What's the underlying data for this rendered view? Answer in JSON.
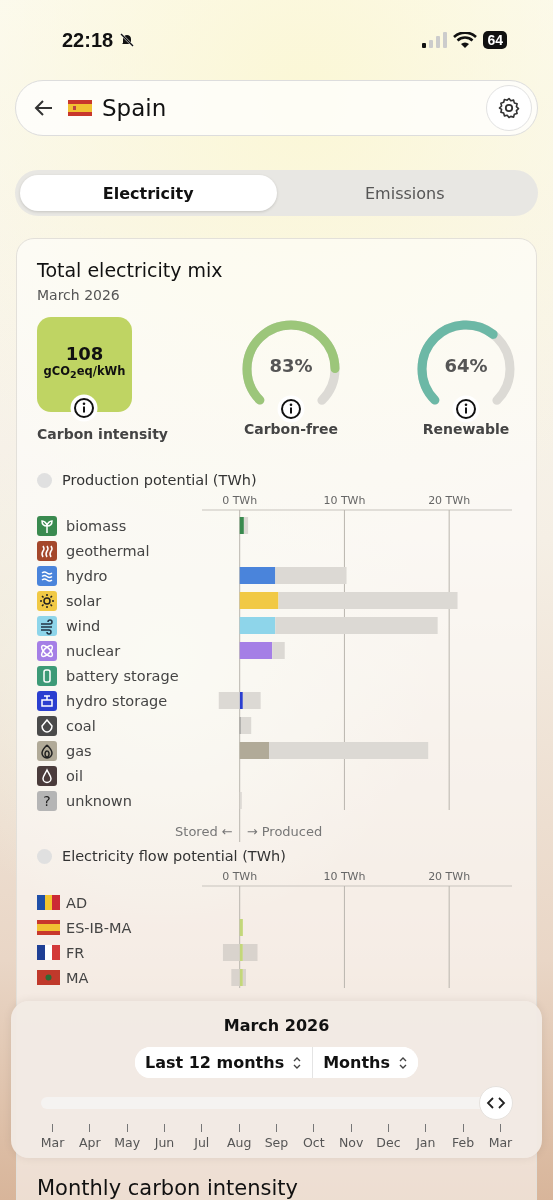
{
  "status_bar": {
    "time": "22:18",
    "battery": "64"
  },
  "header": {
    "title": "Spain"
  },
  "tabs": [
    {
      "label": "Electricity",
      "selected": true
    },
    {
      "label": "Emissions",
      "selected": false
    }
  ],
  "mix": {
    "title": "Total electricity mix",
    "subtitle": "March 2026",
    "intensity": {
      "value": "108",
      "unit": "gCO$_{2}$eq/kWh",
      "label": "Carbon intensity",
      "color": "#bfd463"
    },
    "gauges": [
      {
        "reading": "83%",
        "label": "Carbon-free",
        "level": 0.83,
        "color": "#9cc67a"
      },
      {
        "reading": "64%",
        "label": "Renewable",
        "level": 0.64,
        "color": "#6cb8a6"
      }
    ]
  },
  "production": {
    "title": "Production potential (TWh)",
    "stored_label": "Stored ←",
    "produced_label": "→ Produced",
    "sources": [
      {
        "color": "#3a8a4f"
      },
      {
        "color": "#a4472b"
      },
      {
        "color": "#4a84db"
      },
      {
        "color": "#f1c945"
      },
      {
        "color": "#8ed5ea"
      },
      {
        "color": "#a57fe6"
      },
      {
        "color": "#3d9a77"
      },
      {
        "color": "#2b3fd0"
      },
      {
        "color": "#4a4a4a"
      },
      {
        "color": "#b1aa98"
      },
      {
        "color": "#4a3b3b"
      },
      {
        "color": "#b5b5b5",
        "glyph": "?"
      }
    ],
    "chart_data": {
      "type": "bar",
      "orientation": "horizontal",
      "stacked": true,
      "grid": true,
      "categories": [
        "biomass",
        "geothermal",
        "hydro",
        "solar",
        "wind",
        "nuclear",
        "battery storage",
        "hydro storage",
        "coal",
        "gas",
        "oil",
        "unknown"
      ],
      "xlim": [
        -3.6,
        26
      ],
      "xticks": [
        {
          "value": 0,
          "label": "0 TWh"
        },
        {
          "value": 10,
          "label": "10 TWh"
        },
        {
          "value": 20,
          "label": "20 TWh"
        }
      ],
      "series": [
        {
          "colors": [
            "#3a8a4f",
            null,
            "#4a84db",
            "#f1c945",
            "#8ed5ea",
            "#a57fe6",
            null,
            "#2b3fd0",
            "#8a8a8a",
            "#b1aa98",
            null,
            null
          ],
          "values": [
            0.4,
            0,
            3.4,
            3.7,
            3.4,
            3.1,
            0,
            0.3,
            0.1,
            2.8,
            0,
            0
          ]
        },
        {
          "color": "#dcd9d4",
          "values": [
            0.4,
            0,
            6.8,
            17.1,
            15.5,
            1.2,
            0,
            1.7,
            1.0,
            15.2,
            0,
            0.2
          ]
        },
        {
          "color": "#dcd9d4",
          "values": [
            0,
            0,
            0,
            0,
            0,
            0,
            0,
            -2.0,
            0,
            0,
            0,
            0
          ]
        }
      ]
    }
  },
  "flows": {
    "title": "Electricity flow potential (TWh)",
    "chart_data": {
      "type": "bar",
      "orientation": "horizontal",
      "stacked": true,
      "grid": true,
      "categories": [
        "AD",
        "ES-IB-MA",
        "FR",
        "MA"
      ],
      "xlim": [
        -3.6,
        26
      ],
      "xticks": [
        {
          "value": 0,
          "label": "0 TWh"
        },
        {
          "value": 10,
          "label": "10 TWh"
        },
        {
          "value": 20,
          "label": "20 TWh"
        }
      ],
      "series": [
        {
          "color": "#c3d77a",
          "values": [
            0,
            0.3,
            0.3,
            0.3
          ]
        },
        {
          "color": "#d9d3cd",
          "values": [
            0,
            0,
            1.4,
            0.3
          ]
        },
        {
          "color": "#d9d3cd",
          "values": [
            0,
            0,
            -1.6,
            -0.8
          ]
        }
      ]
    }
  },
  "time_picker": {
    "title": "March 2026",
    "range": "Last 12 months",
    "resolution": "Months",
    "level": 1.0,
    "months": [
      "Mar",
      "Apr",
      "May",
      "Jun",
      "Jul",
      "Aug",
      "Sep",
      "Oct",
      "Nov",
      "Dec",
      "Jan",
      "Feb",
      "Mar"
    ]
  },
  "next_section": {
    "title": "Monthly carbon intensity"
  }
}
